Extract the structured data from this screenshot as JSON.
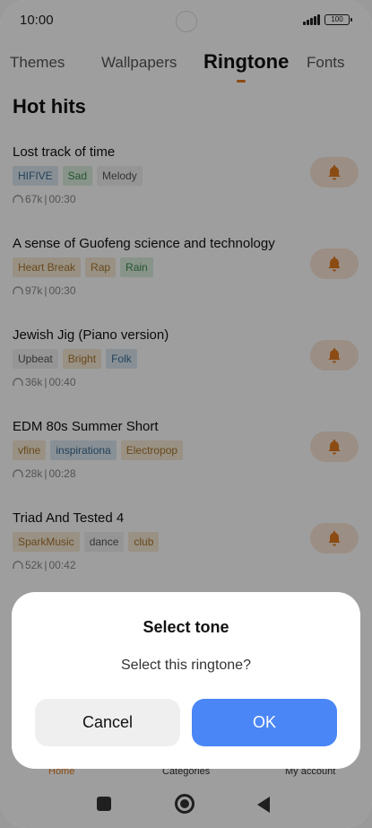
{
  "status_bar": {
    "time": "10:00",
    "battery": "100"
  },
  "tabs": [
    {
      "label": "Themes",
      "active": false
    },
    {
      "label": "Wallpapers",
      "active": false
    },
    {
      "label": "Ringtone",
      "active": true
    },
    {
      "label": "Fonts",
      "active": false
    }
  ],
  "section_title": "Hot hits",
  "songs": [
    {
      "title": "Lost track of time",
      "tags": [
        "HIFIVE",
        "Sad",
        "Melody"
      ],
      "plays": "67k",
      "duration": "00:30"
    },
    {
      "title": "A sense of Guofeng science and technology",
      "tags": [
        "Heart Break",
        "Rap",
        "Rain"
      ],
      "plays": "97k",
      "duration": "00:30"
    },
    {
      "title": "Jewish Jig (Piano version)",
      "tags": [
        "Upbeat",
        "Bright",
        "Folk"
      ],
      "plays": "36k",
      "duration": "00:40"
    },
    {
      "title": "EDM 80s Summer Short",
      "tags": [
        "vfine",
        "inspirationa",
        "Electropop"
      ],
      "plays": "28k",
      "duration": "00:28"
    },
    {
      "title": "Triad And Tested 4",
      "tags": [
        "SparkMusic",
        "dance",
        "club"
      ],
      "plays": "52k",
      "duration": "00:42"
    }
  ],
  "bottom_nav": [
    {
      "label": "Home",
      "active": true
    },
    {
      "label": "Categories",
      "active": false
    },
    {
      "label": "My account",
      "active": false
    }
  ],
  "dialog": {
    "title": "Select tone",
    "message": "Select this ringtone?",
    "cancel_label": "Cancel",
    "ok_label": "OK"
  },
  "colors": {
    "accent": "#e07a1f",
    "ok_button": "#4a86f5"
  }
}
